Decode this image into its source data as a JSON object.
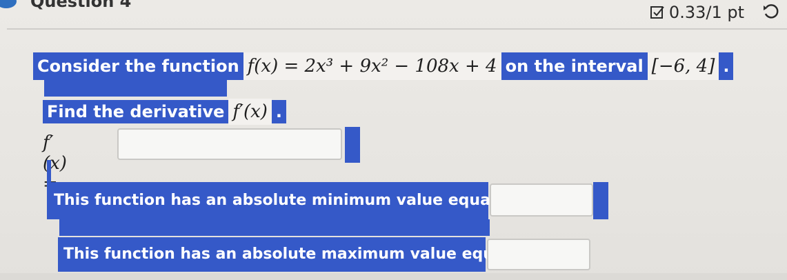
{
  "header": {
    "question_title": "Question 4",
    "score": "0.33/1 pt"
  },
  "problem": {
    "intro_text": "Consider the function",
    "function_expr": "f(x) = 2x³ + 9x² − 108x + 4",
    "interval_text": "on the interval",
    "interval_expr": "[−6, 4]",
    "period": "."
  },
  "derivative": {
    "prompt_text": "Find the derivative",
    "prompt_expr": "f′(x)",
    "period": ".",
    "input_label": "f′(x) =",
    "input_value": ""
  },
  "minimum": {
    "text": "This function has an absolute minimum value equal to",
    "input_value": ""
  },
  "maximum": {
    "text": "This function has an absolute maximum value equal to",
    "input_value": ""
  },
  "colors": {
    "highlight": "#3559c8",
    "background": "#e9e7e3"
  }
}
